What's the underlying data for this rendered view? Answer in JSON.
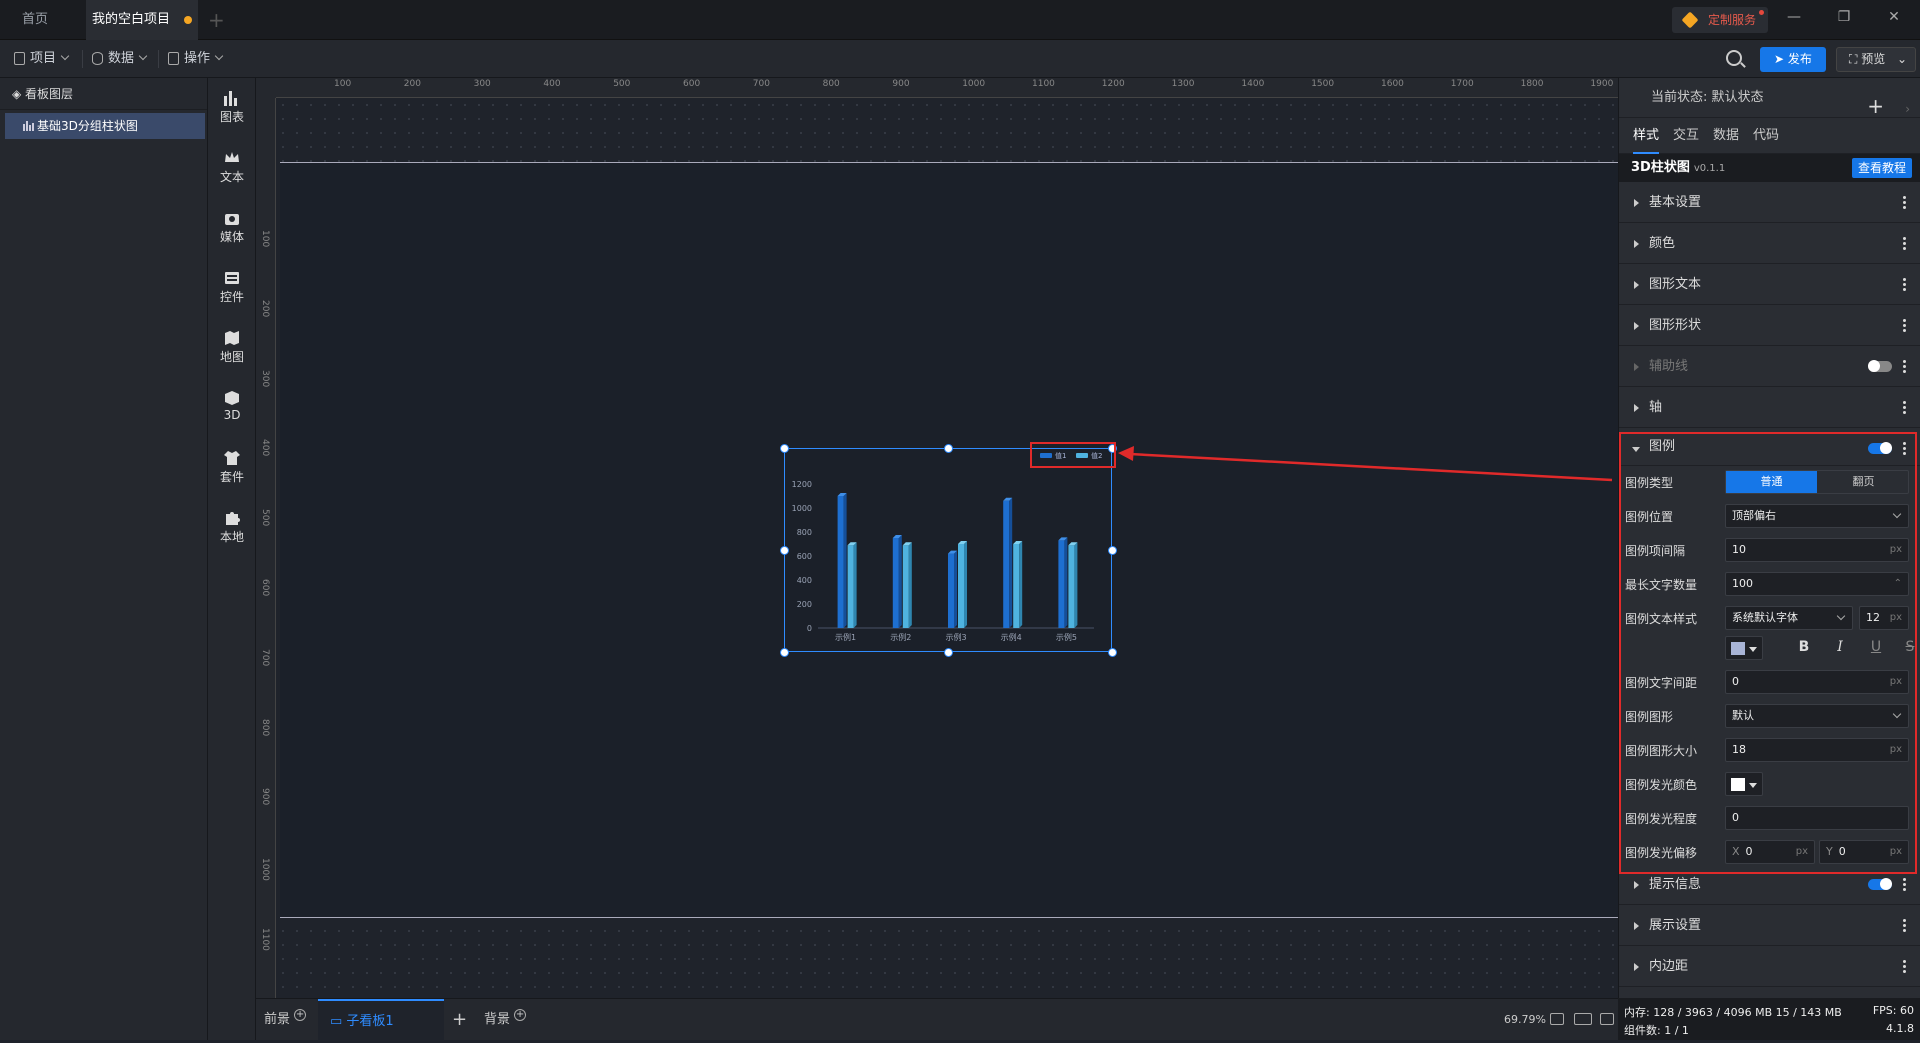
{
  "tabs": [
    {
      "label": "首页",
      "active": false
    },
    {
      "label": "我的空白项目",
      "active": true,
      "unsaved": true
    }
  ],
  "custom_service": "定制服务",
  "toolbar": {
    "menus": [
      "项目",
      "数据",
      "操作"
    ],
    "publish": "发布",
    "preview": "预览"
  },
  "layers": {
    "title": "看板图层",
    "items": [
      "基础3D分组柱状图"
    ]
  },
  "components": [
    "图表",
    "文本",
    "媒体",
    "控件",
    "地图",
    "3D",
    "套件",
    "本地"
  ],
  "ruler": {
    "top": [
      "100",
      "200",
      "300",
      "400",
      "500",
      "600",
      "700",
      "800",
      "900",
      "1000",
      "1100",
      "1200",
      "1300",
      "1400",
      "1500",
      "1600",
      "1700",
      "1800",
      "1900"
    ],
    "left": [
      "100",
      "200",
      "300",
      "400",
      "500",
      "600",
      "700",
      "800",
      "900",
      "1000",
      "1100"
    ]
  },
  "chart_data": {
    "type": "bar",
    "categories": [
      "示例1",
      "示例2",
      "示例3",
      "示例4",
      "示例5"
    ],
    "series": [
      {
        "name": "值1",
        "values": [
          1100,
          750,
          620,
          1060,
          730
        ]
      },
      {
        "name": "值2",
        "values": [
          690,
          690,
          700,
          700,
          690
        ]
      }
    ],
    "yticks": [
      "0",
      "200",
      "400",
      "600",
      "800",
      "1000",
      "1200"
    ],
    "ylim": [
      0,
      1200
    ],
    "legend_position": "top-right",
    "colors": [
      "#1e6fd0",
      "#4fb3e0"
    ]
  },
  "bottom_tabs": {
    "front": "前景",
    "sub_board": "子看板1",
    "background": "背景",
    "zoom": "69.79%"
  },
  "panel": {
    "state_label": "当前状态:",
    "state_value": "默认状态",
    "tabs": [
      "样式",
      "交互",
      "数据",
      "代码"
    ],
    "component_name": "3D柱状图",
    "version": "v0.1.1",
    "tutorial": "查看教程",
    "sections_top": [
      "基本设置",
      "颜色",
      "图形文本",
      "图形形状",
      "辅助线",
      "轴"
    ],
    "legend_section": "图例",
    "sections_bottom": [
      "提示信息",
      "展示设置",
      "内边距"
    ],
    "legend": {
      "type_label": "图例类型",
      "type_options": [
        "普通",
        "翻页"
      ],
      "position_label": "图例位置",
      "position_value": "顶部偏右",
      "gap_label": "图例项间隔",
      "gap_value": "10",
      "maxlen_label": "最长文字数量",
      "maxlen_value": "100",
      "textstyle_label": "图例文本样式",
      "font_value": "系统默认字体",
      "font_size": "12",
      "text_color": "#a8b4d6",
      "textgap_label": "图例文字间距",
      "textgap_value": "0",
      "shape_label": "图例图形",
      "shape_value": "默认",
      "shapesize_label": "图例图形大小",
      "shapesize_value": "18",
      "glowcolor_label": "图例发光颜色",
      "glow_color": "#ffffff",
      "glowlevel_label": "图例发光程度",
      "glowlevel_value": "0",
      "glowoffset_label": "图例发光偏移",
      "offset_x": "0",
      "offset_y": "0",
      "unit": "px"
    }
  },
  "status": {
    "memory": "内存:  128 / 3963 / 4096 MB  15 / 143 MB",
    "fps": "FPS:  60",
    "components": "组件数: 1 / 1",
    "version": "4.1.8"
  }
}
